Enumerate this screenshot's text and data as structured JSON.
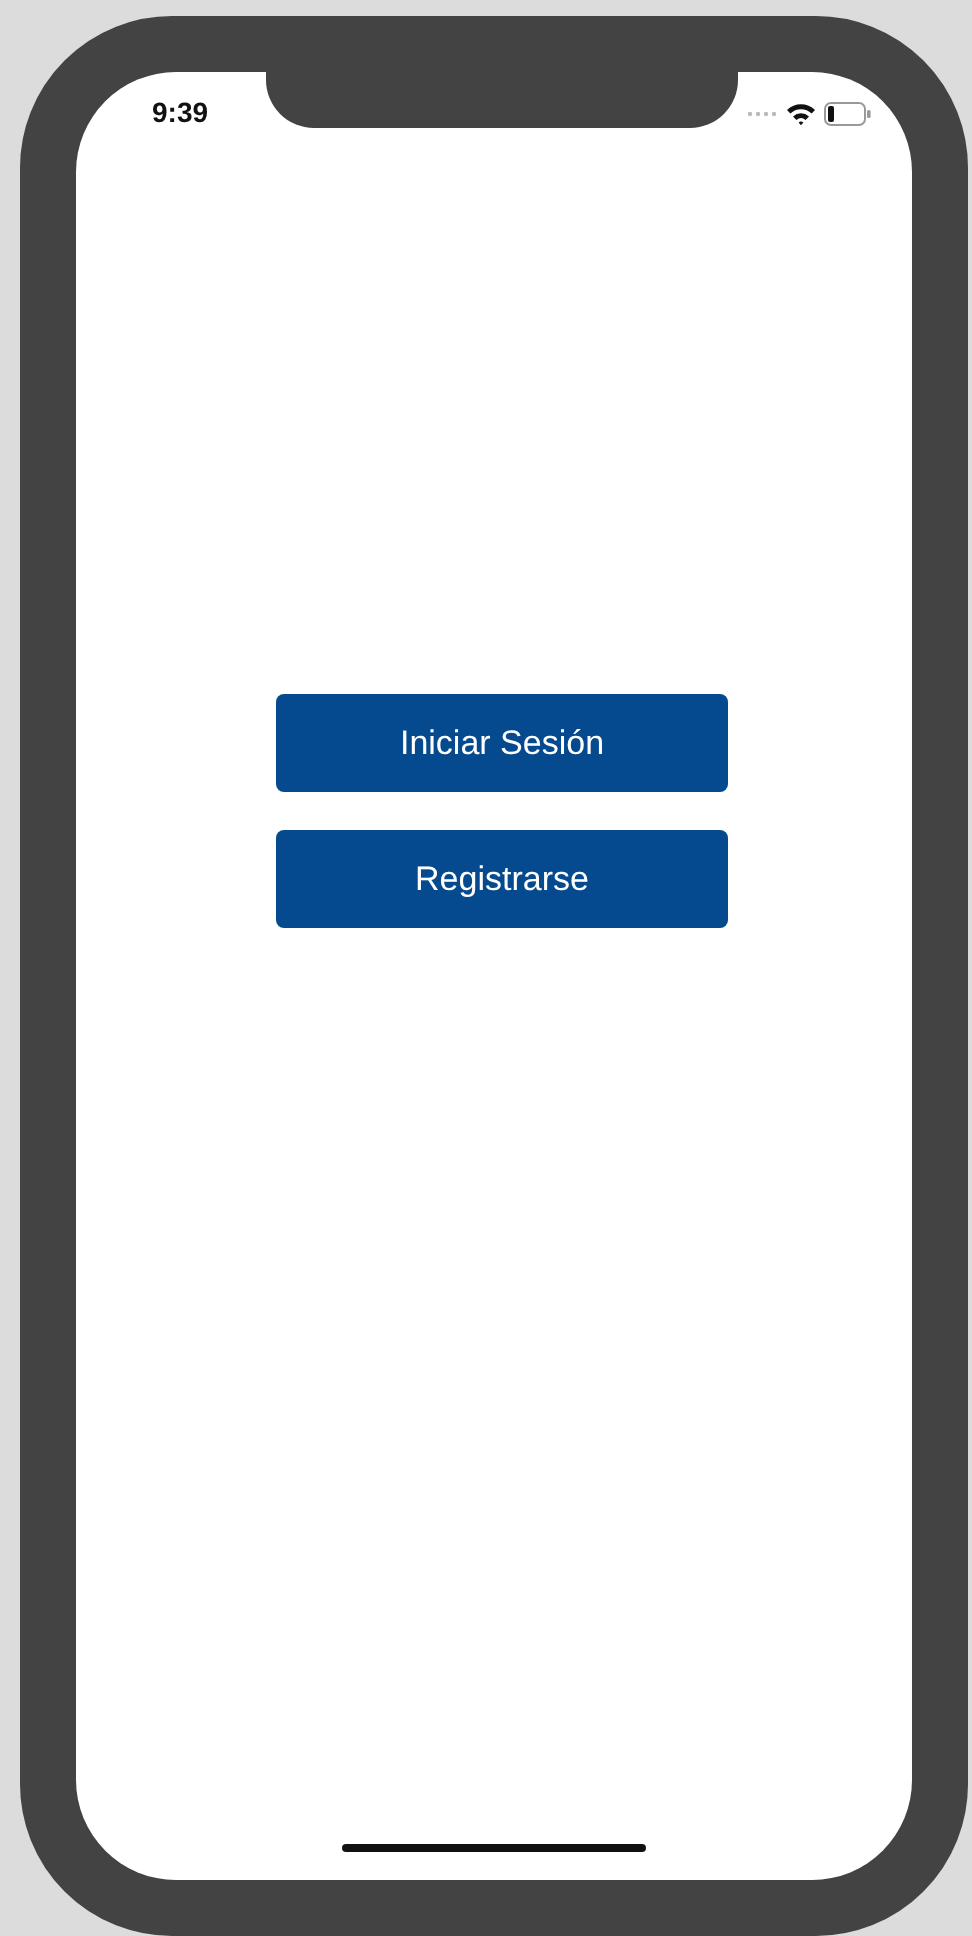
{
  "status_bar": {
    "time": "9:39"
  },
  "buttons": [
    {
      "label": "Iniciar Sesión"
    },
    {
      "label": "Registrarse"
    }
  ]
}
